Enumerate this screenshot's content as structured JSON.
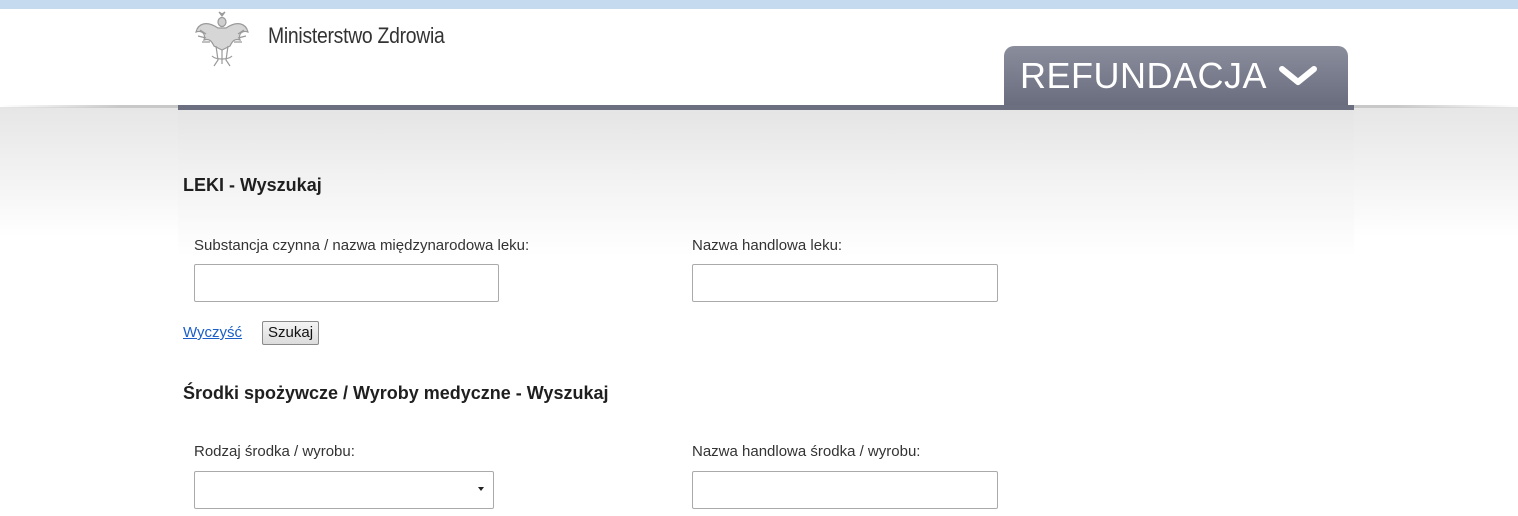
{
  "header": {
    "ministry_name": "Ministerstwo Zdrowia",
    "logo_icon": "polish-eagle-emblem-icon",
    "nav_tab_label": "REFUNDACJA",
    "nav_tab_icon": "chevron-down-icon"
  },
  "drugs_search": {
    "title": "LEKI - Wyszukaj",
    "substance_label": "Substancja czynna / nazwa międzynarodowa leku:",
    "substance_value": "",
    "trade_name_label": "Nazwa handlowa leku:",
    "trade_name_value": "",
    "clear_link": "Wyczyść",
    "search_button": "Szukaj"
  },
  "foods_devices_search": {
    "title": "Środki spożywcze / Wyroby medyczne - Wyszukaj",
    "type_label": "Rodzaj środka / wyrobu:",
    "type_selected": "",
    "trade_name_label": "Nazwa handlowa środka / wyrobu:",
    "trade_name_value": ""
  },
  "colors": {
    "accent_tab": "#6a6d7e",
    "link": "#1a5fc8",
    "top_strip": "#c5d9ef"
  }
}
